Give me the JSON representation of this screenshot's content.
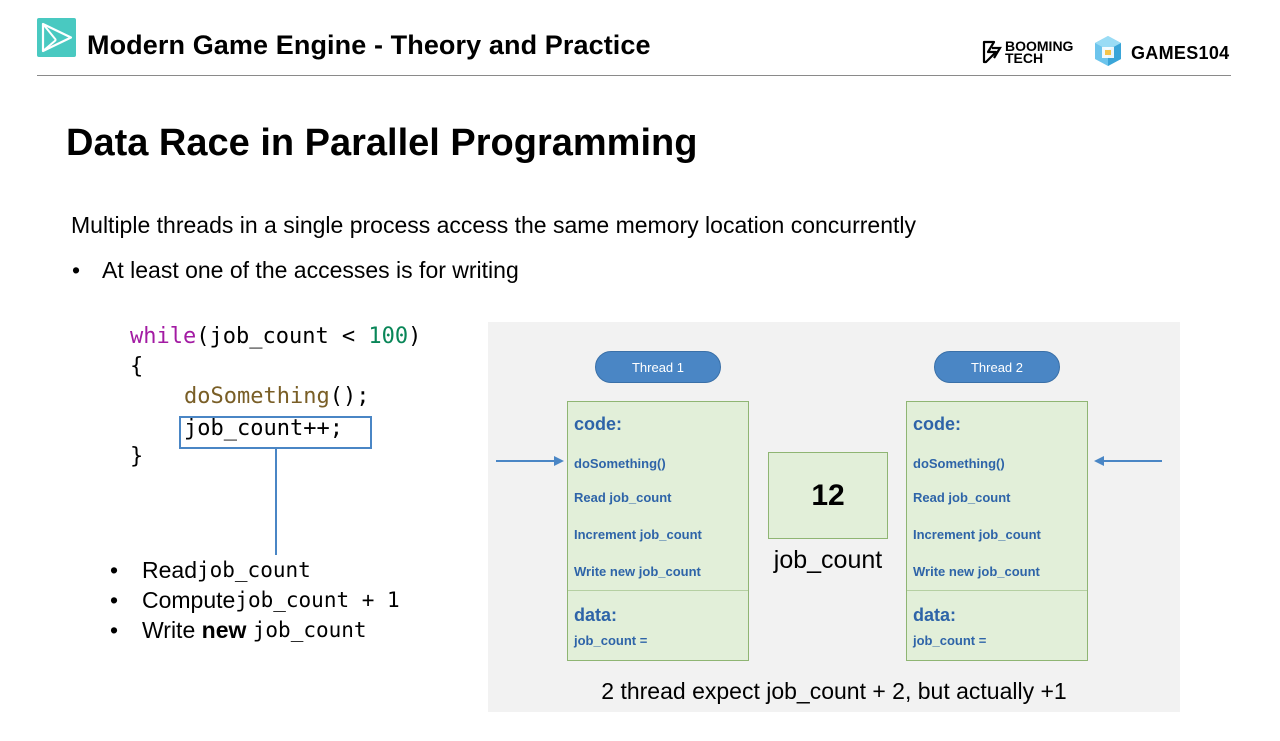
{
  "header": {
    "title": "Modern Game Engine - Theory and Practice",
    "booming_tech_line1": "BOOMING",
    "booming_tech_line2": "TECH",
    "games_logo": "GAMES104"
  },
  "slide": {
    "title": "Data Race in Parallel Programming",
    "intro": "Multiple threads in a single process access the same memory location concurrently",
    "bullet": "At least one of the accesses is for writing",
    "bullet_marker": "•"
  },
  "code": {
    "line1_kw": "while",
    "line1_rest": "(job_count < ",
    "line1_num": "100",
    "line1_end": ")",
    "line2": "{",
    "line3_fn": "doSomething",
    "line3_rest": "();",
    "line4": "job_count++;",
    "line5": "}"
  },
  "steps": [
    {
      "text": "Read ",
      "mono": "job_count"
    },
    {
      "text": "Compute ",
      "mono": "job_count + 1"
    },
    {
      "text_before": "Write ",
      "bold": "new",
      "mono": "job_count"
    }
  ],
  "diagram": {
    "thread1": {
      "pill": "Thread 1",
      "code_header": "code:",
      "lines": [
        "doSomething()",
        "Read job_count",
        "Increment job_count",
        "Write new job_count"
      ],
      "data_header": "data:",
      "data_line": "job_count ="
    },
    "thread2": {
      "pill": "Thread 2",
      "code_header": "code:",
      "lines": [
        "doSomething()",
        "Read job_count",
        "Increment job_count",
        "Write new job_count"
      ],
      "data_header": "data:",
      "data_line": "job_count ="
    },
    "shared_value": "12",
    "shared_label": "job_count",
    "caption": "2 thread expect job_count + 2, but actually +1"
  },
  "colors": {
    "accent_teal": "#49c9c1",
    "thread_blue": "#4a86c5",
    "box_green": "#e2efd9",
    "label_blue": "#2e64a8"
  }
}
